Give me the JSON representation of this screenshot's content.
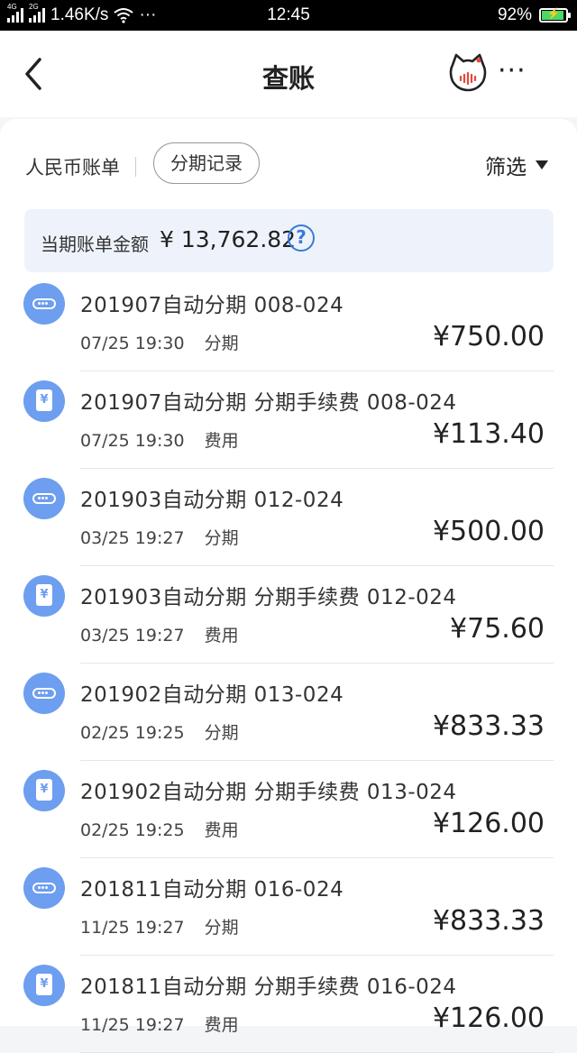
{
  "status_bar": {
    "net1": "4G",
    "net2": "2G",
    "speed": "1.46K/s",
    "dots": "···",
    "time": "12:45",
    "battery": "92%",
    "battery_level": 0.92
  },
  "nav": {
    "title": "查账",
    "more": "···"
  },
  "filters": {
    "rmb_bill": "人民币账单",
    "installment_records": "分期记录",
    "filter": "筛选"
  },
  "summary": {
    "label": "当期账单金额",
    "amount": "¥ 13,762.82",
    "help": "?"
  },
  "colors": {
    "accent": "#3a7ad8",
    "icon_bg": "#6d9ef0",
    "summary_bg": "#eef3fb"
  },
  "transactions": [
    {
      "icon": "installment-icon",
      "title": "201907自动分期   008-024",
      "time": "07/25 19:30",
      "type": "分期",
      "amount": "¥750.00"
    },
    {
      "icon": "fee-icon",
      "title": "201907自动分期  分期手续费 008-024",
      "time": "07/25 19:30",
      "type": "费用",
      "amount": "¥113.40"
    },
    {
      "icon": "installment-icon",
      "title": "201903自动分期   012-024",
      "time": "03/25 19:27",
      "type": "分期",
      "amount": "¥500.00"
    },
    {
      "icon": "fee-icon",
      "title": "201903自动分期  分期手续费 012-024",
      "time": "03/25 19:27",
      "type": "费用",
      "amount": "¥75.60"
    },
    {
      "icon": "installment-icon",
      "title": "201902自动分期   013-024",
      "time": "02/25 19:25",
      "type": "分期",
      "amount": "¥833.33"
    },
    {
      "icon": "fee-icon",
      "title": "201902自动分期  分期手续费 013-024",
      "time": "02/25 19:25",
      "type": "费用",
      "amount": "¥126.00"
    },
    {
      "icon": "installment-icon",
      "title": "201811自动分期   016-024",
      "time": "11/25 19:27",
      "type": "分期",
      "amount": "¥833.33"
    },
    {
      "icon": "fee-icon",
      "title": "201811自动分期  分期手续费 016-024",
      "time": "11/25 19:27",
      "type": "费用",
      "amount": "¥126.00"
    }
  ]
}
